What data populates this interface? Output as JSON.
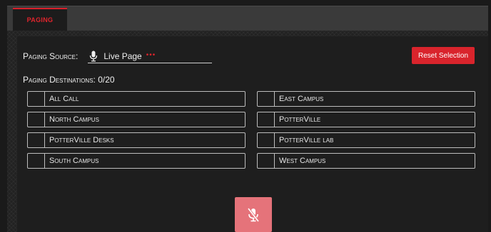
{
  "tabs": [
    {
      "label": "PAGING",
      "active": true
    }
  ],
  "source": {
    "label": "Paging Source:",
    "icon": "microphone-icon",
    "value": "Live Page",
    "more_icon": "more-dots-icon"
  },
  "reset_label": "Reset Selection",
  "destinations": {
    "label": "Paging Destinations: 0/20",
    "left": [
      "All Call",
      "North Campus",
      "PotterVille Desks",
      "South Campus"
    ],
    "right": [
      "East Campus",
      "PotterVille",
      "PotterVille lab",
      "West Campus"
    ]
  },
  "mute_button": {
    "icon": "microphone-off-icon"
  },
  "colors": {
    "accent": "#d9242c",
    "mute_bg": "#e5737a",
    "panel": "#1e1e1e",
    "tabbar": "#3a3a3a"
  }
}
